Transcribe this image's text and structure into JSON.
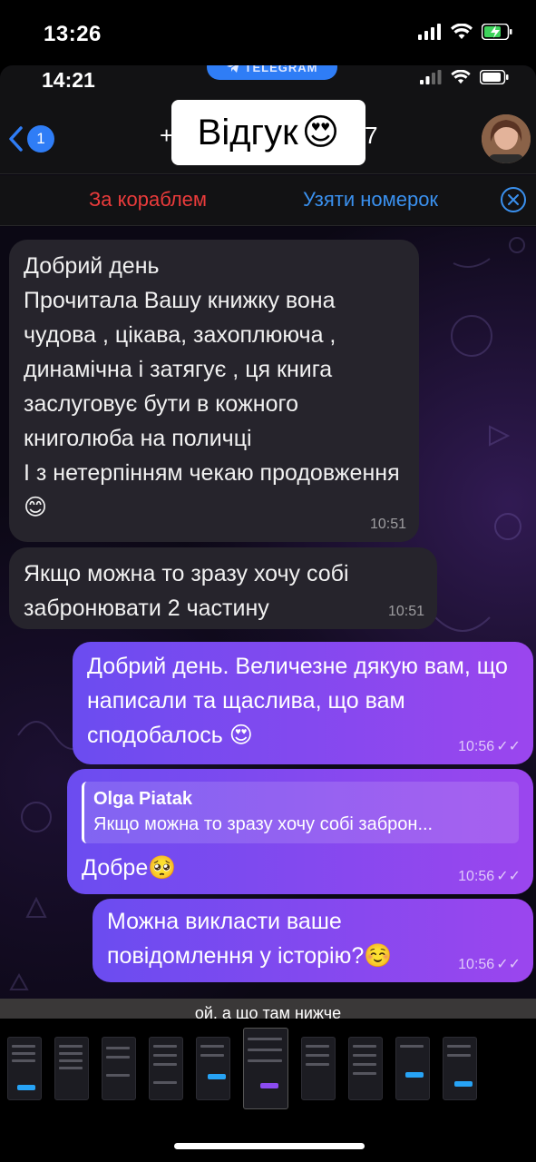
{
  "outer_status": {
    "time": "13:26"
  },
  "inner_status": {
    "time": "14:21",
    "telegram_label": "TELEGRAM"
  },
  "navbar": {
    "back_badge": "1",
    "title_left_fragment": "+",
    "title_right_fragment": "7"
  },
  "sticker": {
    "text": "Відгук",
    "emoji": "😍"
  },
  "action_bar": {
    "left_label": "За кораблем",
    "right_label": "Узяти номерок"
  },
  "messages": [
    {
      "text": "Добрий день\nПрочитала Вашу книжку вона чудова , цікава, захоплююча , динамічна і затягує , ця книга заслуговує бути в кожного книголюба на поличці\nІ з нетерпінням чекаю продовження 😊",
      "time": "10:51"
    },
    {
      "text": "Якщо можна то зразу хочу собі забронювати 2 частину",
      "time": "10:51"
    },
    {
      "text": "Добрий день. Величезне дякую вам, що написали та щаслива, що вам сподобалось 😍",
      "time": "10:56",
      "ticks": "✓✓"
    },
    {
      "reply_name": "Olga Piatak",
      "reply_text": "Якщо можна то зразу хочу собі заброн...",
      "text": "Добре🥺",
      "time": "10:56",
      "ticks": "✓✓"
    },
    {
      "text": "Можна викласти ваше повідомлення у історію?☺️",
      "time": "10:56",
      "ticks": "✓✓"
    }
  ],
  "caption": {
    "text": "ой, а що там нижче"
  },
  "colors": {
    "incoming": "#26242c",
    "outgoing_start": "#6b4cf0",
    "outgoing_end": "#9b46ee",
    "accent_blue": "#2f7df6",
    "accent_red": "#ea3b3b"
  }
}
